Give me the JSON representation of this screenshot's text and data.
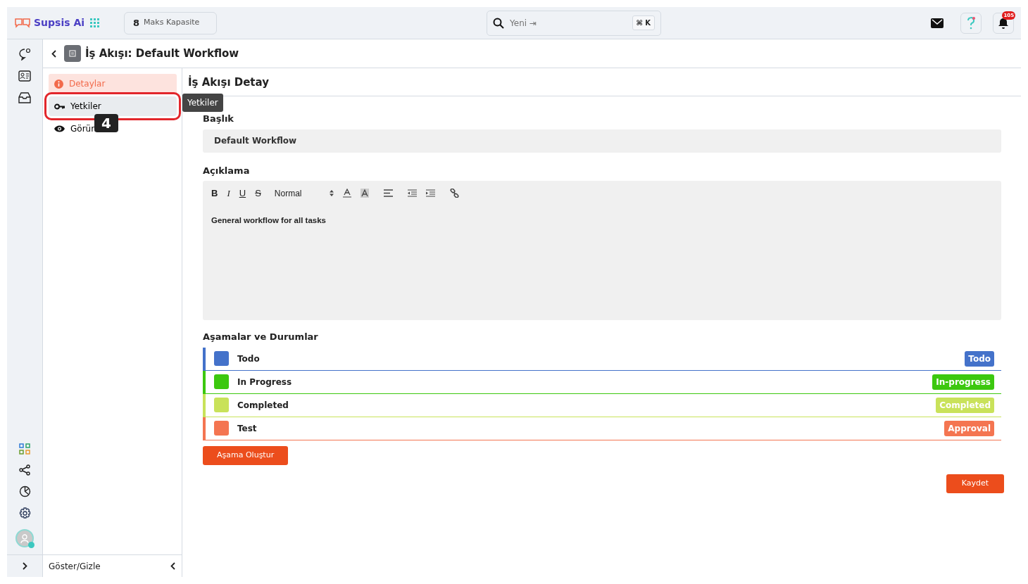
{
  "brand": {
    "name": "Supsis Ai"
  },
  "capacity": {
    "count": "8",
    "label": "Maks Kapasite"
  },
  "search": {
    "placeholder": "Yeni ⇥",
    "shortcut": "⌘ K"
  },
  "notifications": {
    "count": "105"
  },
  "page": {
    "title": "İş Akışı: Default Workflow"
  },
  "nav": {
    "items": [
      {
        "label": "Detaylar",
        "kind": "info",
        "selected": true,
        "highlighted": false
      },
      {
        "label": "Yetkiler",
        "kind": "key",
        "selected": false,
        "highlighted": true
      },
      {
        "label": "Görün",
        "kind": "eye",
        "selected": false,
        "highlighted": false
      }
    ],
    "footer": "Göster/Gizle"
  },
  "tooltip": "Yetkiler",
  "step_marker": "4",
  "toolbar": [
    "B",
    "I",
    "U",
    "S"
  ],
  "detail": {
    "title": "İş Akışı Detay",
    "name_label": "Başlık",
    "name_value": "Default Workflow",
    "description_label": "Açıklama",
    "format": "Normal",
    "description": "General workflow for all tasks"
  },
  "stages": {
    "title": "Aşamalar ve Durumlar",
    "items": [
      {
        "name": "Todo",
        "status": "Todo",
        "color": "#4472ca"
      },
      {
        "name": "In Progress",
        "status": "In-progress",
        "color": "#3cc80f"
      },
      {
        "name": "Completed",
        "status": "Completed",
        "color": "#c9e25a"
      },
      {
        "name": "Test",
        "status": "Approval",
        "color": "#f47551"
      }
    ]
  },
  "buttons": {
    "create": "Aşama Oluştur",
    "save": "Kaydet"
  }
}
